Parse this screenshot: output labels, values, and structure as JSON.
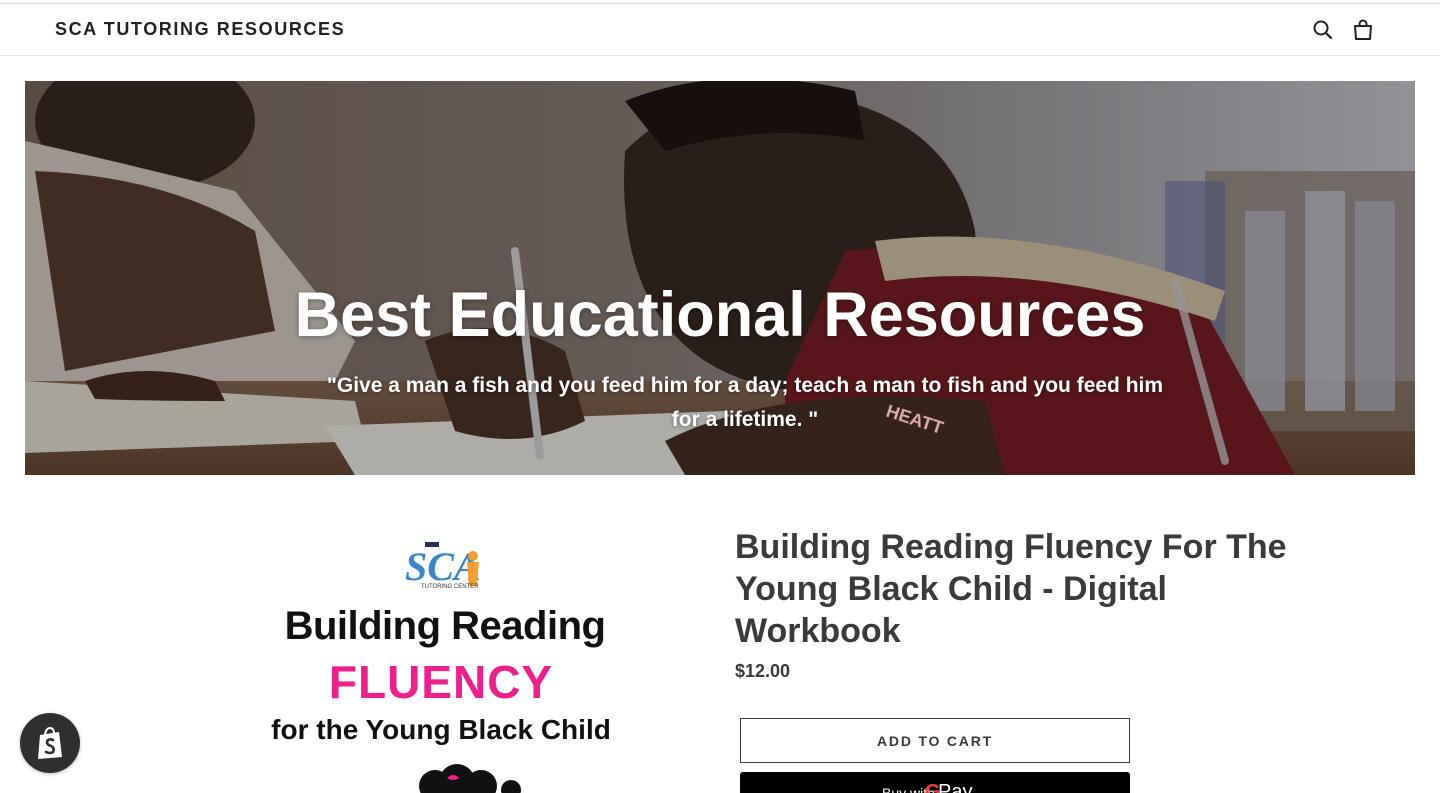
{
  "header": {
    "site_title": "SCA TUTORING RESOURCES",
    "icons": [
      "search-icon",
      "cart-icon"
    ]
  },
  "hero": {
    "title": "Best Educational Resources",
    "quote": "\"Give a man a fish and you feed him for a day; teach a man to fish and you feed him for a lifetime. \"",
    "shirt_text": "HEATT"
  },
  "product": {
    "image": {
      "logo_text": "SCA",
      "logo_subtext": "TUTORING CENTER",
      "line1": "Building Reading",
      "line2": "FLUENCY",
      "line3": "for the Young Black Child"
    },
    "title": "Building Reading Fluency For The Young Black Child - Digital Workbook",
    "price": "$12.00",
    "add_to_cart_label": "ADD TO CART",
    "gpay": {
      "prefix": "Buy with",
      "g": "G",
      "word": "Pay"
    }
  },
  "shopify_badge": {
    "icon": "shopify-bag-icon"
  },
  "colors": {
    "accent_pink": "#ee1f8c",
    "text_dark": "#3a3a3a",
    "button_black": "#000000"
  }
}
